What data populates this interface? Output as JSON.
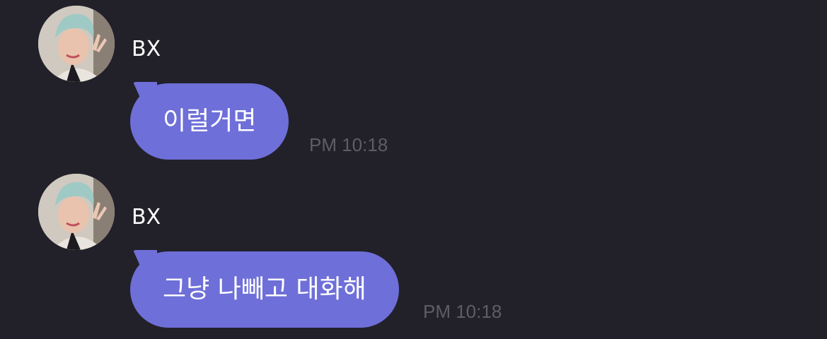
{
  "messages": [
    {
      "sender": "BX",
      "text": "이럴거면",
      "time": "PM 10:18"
    },
    {
      "sender": "BX",
      "text": "그냥 나빼고 대화해",
      "time": "PM 10:18"
    }
  ],
  "colors": {
    "background": "#22212a",
    "bubble": "#6e6fd8",
    "timestamp": "#5e5d66",
    "sender_name": "#ffffff"
  }
}
